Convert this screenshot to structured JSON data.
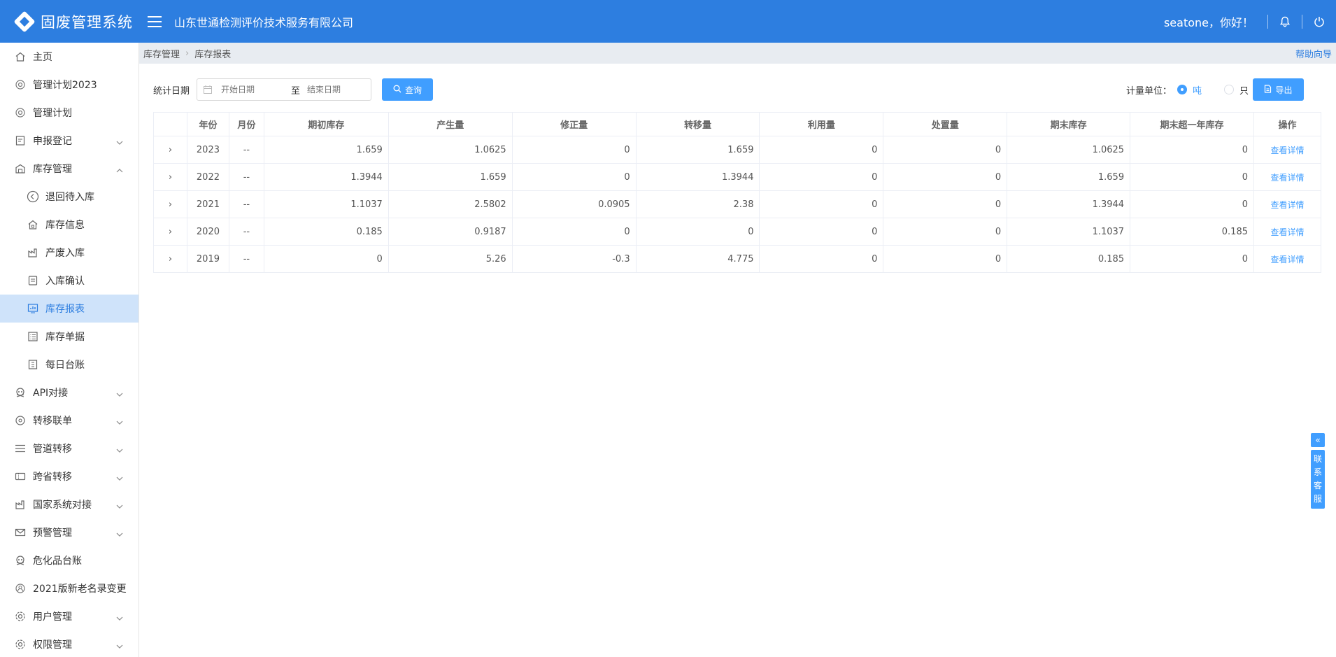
{
  "app": {
    "title": "固废管理系统",
    "company": "山东世通检测评价技术服务有限公司",
    "greeting": "seatone，你好！"
  },
  "colors": {
    "primary": "#2d7ee0",
    "accent": "#409eff",
    "active_bg": "#cfe3fa"
  },
  "sidebar": {
    "items": [
      {
        "label": "主页",
        "icon": "home-icon"
      },
      {
        "label": "管理计划2023",
        "icon": "plan-icon"
      },
      {
        "label": "管理计划",
        "icon": "plan-icon"
      },
      {
        "label": "申报登记",
        "icon": "form-icon"
      },
      {
        "label": "库存管理",
        "icon": "warehouse-icon"
      },
      {
        "label": "退回待入库",
        "icon": "return-icon"
      },
      {
        "label": "库存信息",
        "icon": "house-icon"
      },
      {
        "label": "产废入库",
        "icon": "factory-icon"
      },
      {
        "label": "入库确认",
        "icon": "doc-check-icon"
      },
      {
        "label": "库存报表",
        "icon": "report-chart-icon"
      },
      {
        "label": "库存单据",
        "icon": "list-icon"
      },
      {
        "label": "每日台账",
        "icon": "ledger-icon"
      },
      {
        "label": "API对接",
        "icon": "skull-icon"
      },
      {
        "label": "转移联单",
        "icon": "transfer-icon"
      },
      {
        "label": "管道转移",
        "icon": "menu-lines-icon"
      },
      {
        "label": "跨省转移",
        "icon": "ticket-icon"
      },
      {
        "label": "国家系统对接",
        "icon": "building-icon"
      },
      {
        "label": "预警管理",
        "icon": "mail-icon"
      },
      {
        "label": "危化品台账",
        "icon": "skull-icon"
      },
      {
        "label": "2021版新老名录变更",
        "icon": "badge-icon"
      },
      {
        "label": "用户管理",
        "icon": "gear-icon"
      },
      {
        "label": "权限管理",
        "icon": "gear-icon"
      }
    ]
  },
  "breadcrumb": {
    "level1": "库存管理",
    "level2": "库存报表",
    "help": "帮助向导"
  },
  "filter": {
    "label": "统计日期",
    "start_placeholder": "开始日期",
    "to": "至",
    "end_placeholder": "结束日期",
    "query": "查询"
  },
  "unit": {
    "label": "计量单位：",
    "option1": "吨",
    "option2": "只",
    "export": "导出"
  },
  "table": {
    "headers": [
      "",
      "年份",
      "月份",
      "期初库存",
      "产生量",
      "修正量",
      "转移量",
      "利用量",
      "处置量",
      "期末库存",
      "期末超一年库存",
      "操作"
    ],
    "rows": [
      [
        "2023",
        "--",
        "1.659",
        "1.0625",
        "0",
        "1.659",
        "0",
        "0",
        "1.0625",
        "0",
        "查看详情"
      ],
      [
        "2022",
        "--",
        "1.3944",
        "1.659",
        "0",
        "1.3944",
        "0",
        "0",
        "1.659",
        "0",
        "查看详情"
      ],
      [
        "2021",
        "--",
        "1.1037",
        "2.5802",
        "0.0905",
        "2.38",
        "0",
        "0",
        "1.3944",
        "0",
        "查看详情"
      ],
      [
        "2020",
        "--",
        "0.185",
        "0.9187",
        "0",
        "0",
        "0",
        "0",
        "1.1037",
        "0.185",
        "查看详情"
      ],
      [
        "2019",
        "--",
        "0",
        "5.26",
        "-0.3",
        "4.775",
        "0",
        "0",
        "0.185",
        "0",
        "查看详情"
      ]
    ]
  },
  "service": {
    "chars": [
      "联",
      "系",
      "客",
      "服"
    ]
  }
}
